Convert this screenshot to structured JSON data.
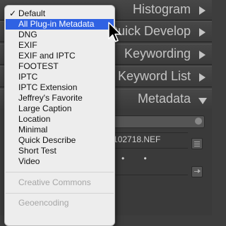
{
  "panels": [
    {
      "title": "Histogram",
      "state": "collapsed"
    },
    {
      "title": "Quick Develop",
      "state": "collapsed"
    },
    {
      "title": "Keywording",
      "state": "collapsed"
    },
    {
      "title": "Keyword List",
      "state": "collapsed"
    },
    {
      "title": "Metadata",
      "state": "expanded"
    }
  ],
  "metadata": {
    "filename_fragment": "102718.NEF",
    "dots": "• •"
  },
  "menu": {
    "selected": "Default",
    "highlighted": "All Plug-in Metadata",
    "check_mark": "✓",
    "items": [
      {
        "label": "Default"
      },
      {
        "label": "All Plug-in Metadata"
      },
      {
        "label": "DNG"
      },
      {
        "label": "EXIF"
      },
      {
        "label": "EXIF and IPTC"
      },
      {
        "label": "FOOTEST"
      },
      {
        "label": "IPTC"
      },
      {
        "label": "IPTC Extension"
      },
      {
        "label": "Jeffrey's Favorite"
      },
      {
        "label": "Large Caption"
      },
      {
        "label": "Location"
      },
      {
        "label": "Minimal"
      },
      {
        "label": "Quick Describe"
      },
      {
        "label": "Short Test"
      },
      {
        "label": "Video"
      }
    ],
    "disabled_items": [
      {
        "label": "Creative Commons"
      },
      {
        "label": "Geoencoding"
      }
    ]
  },
  "colors": {
    "menu_highlight": "#2f62e3",
    "menu_background": "#ededed",
    "panel_background": "#3f3f3f",
    "panel_text": "#c4c4c4"
  }
}
